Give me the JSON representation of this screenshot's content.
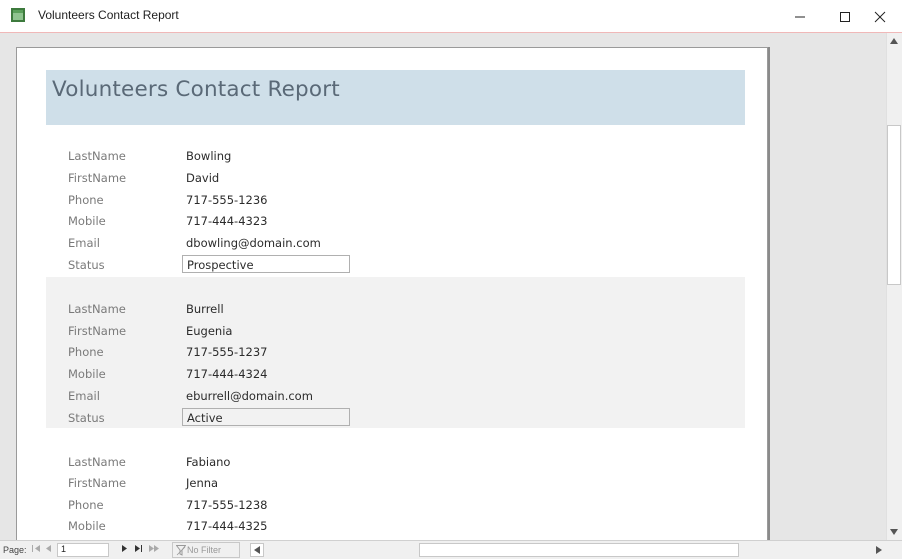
{
  "window": {
    "title": "Volunteers Contact Report",
    "minimize_icon": "minimize-icon",
    "maximize_icon": "maximize-icon",
    "close_icon": "close-icon"
  },
  "report": {
    "title": "Volunteers Contact Report",
    "header_color": "#cfdfe9",
    "labels": {
      "last_name": "LastName",
      "first_name": "FirstName",
      "phone": "Phone",
      "mobile": "Mobile",
      "email": "Email",
      "status": "Status"
    },
    "records": [
      {
        "last_name": "Bowling",
        "first_name": "David",
        "phone": "717-555-1236",
        "mobile": "717-444-4323",
        "email": "dbowling@domain.com",
        "status": "Prospective"
      },
      {
        "last_name": "Burrell",
        "first_name": "Eugenia",
        "phone": "717-555-1237",
        "mobile": "717-444-4324",
        "email": "eburrell@domain.com",
        "status": "Active"
      },
      {
        "last_name": "Fabiano",
        "first_name": "Jenna",
        "phone": "717-555-1238",
        "mobile": "717-444-4325",
        "email": "",
        "status": ""
      }
    ]
  },
  "navigation": {
    "page_label": "Page:",
    "page_value": "1",
    "filter_label": "No Filter"
  }
}
